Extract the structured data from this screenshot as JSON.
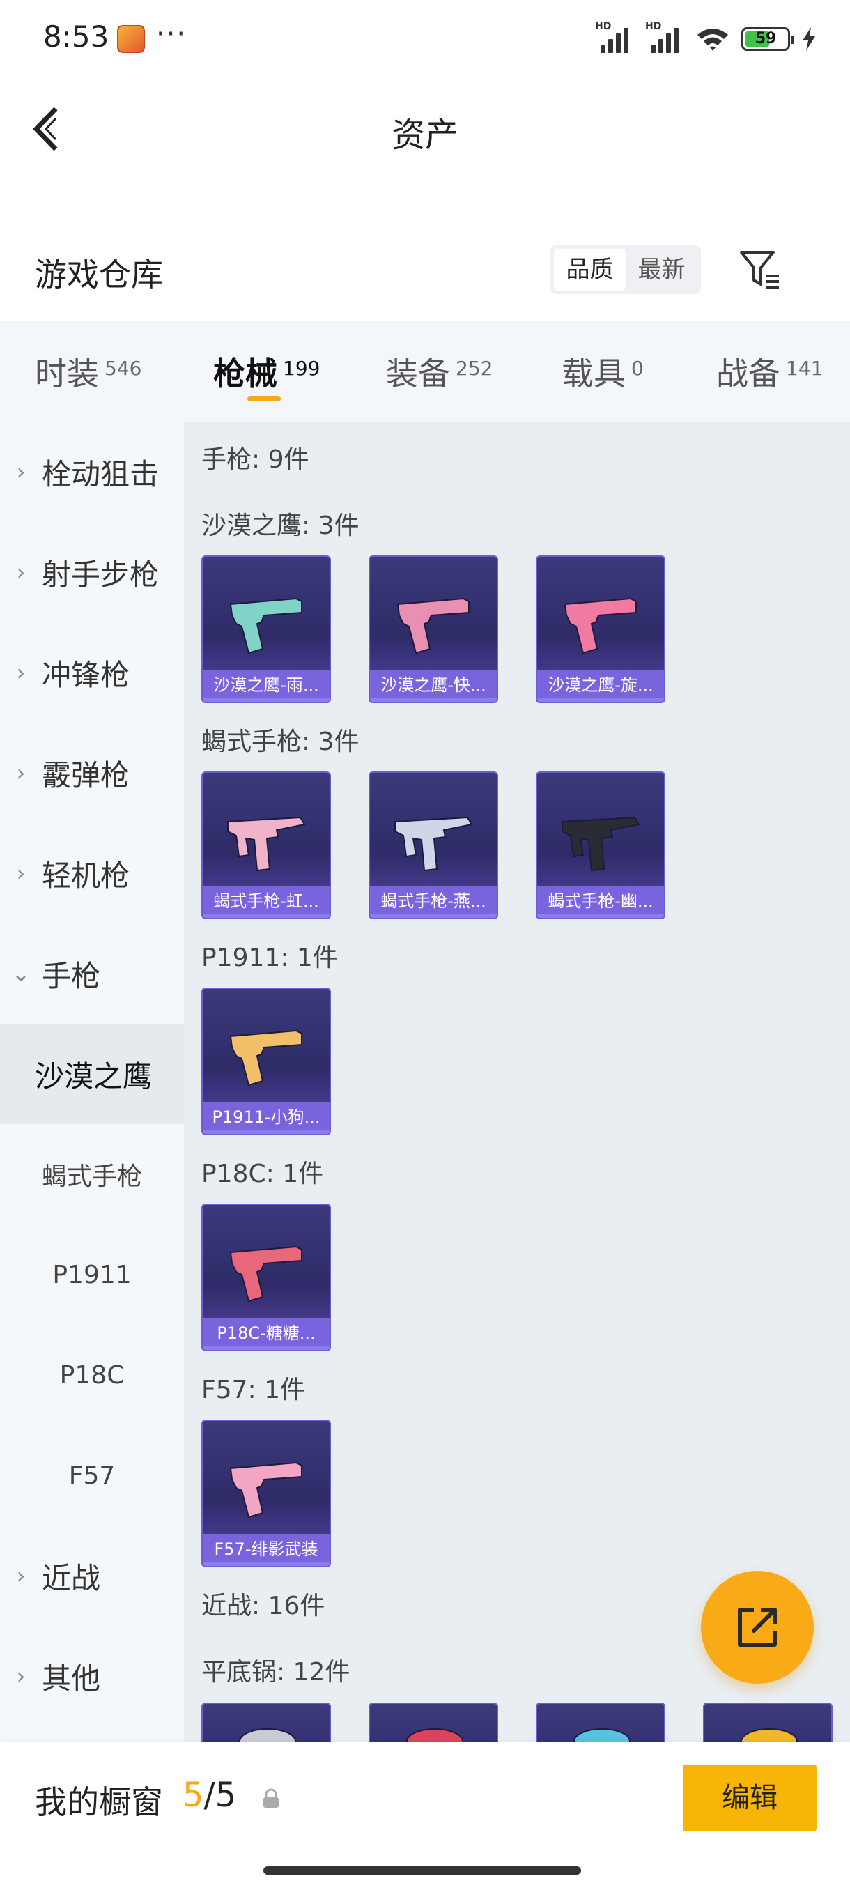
{
  "status_bar": {
    "time": "8:53",
    "dots": "···",
    "battery": "59"
  },
  "nav": {
    "title": "资产"
  },
  "header": {
    "title": "游戏仓库",
    "sort_quality": "品质",
    "sort_newest": "最新"
  },
  "tabs": [
    {
      "label": "时装",
      "count": "546"
    },
    {
      "label": "枪械",
      "count": "199"
    },
    {
      "label": "装备",
      "count": "252"
    },
    {
      "label": "载具",
      "count": "0"
    },
    {
      "label": "战备",
      "count": "141"
    }
  ],
  "sidebar": {
    "items": [
      {
        "label": "栓动狙击",
        "chevron": "›"
      },
      {
        "label": "射手步枪",
        "chevron": "›"
      },
      {
        "label": "冲锋枪",
        "chevron": "›"
      },
      {
        "label": "霰弹枪",
        "chevron": "›"
      },
      {
        "label": "轻机枪",
        "chevron": "›"
      },
      {
        "label": "手枪",
        "chevron": "⌄"
      },
      {
        "label": "沙漠之鹰"
      },
      {
        "label": "蝎式手枪"
      },
      {
        "label": "P1911"
      },
      {
        "label": "P18C"
      },
      {
        "label": "F57"
      },
      {
        "label": "近战",
        "chevron": "›"
      },
      {
        "label": "其他",
        "chevron": "›"
      }
    ]
  },
  "content": {
    "sections": [
      {
        "title": "手枪: 9件"
      },
      {
        "title": "沙漠之鹰: 3件",
        "cards": [
          {
            "name": "沙漠之鹰-雨...",
            "color": "#7fd3c7"
          },
          {
            "name": "沙漠之鹰-快...",
            "color": "#e88fb2"
          },
          {
            "name": "沙漠之鹰-旋...",
            "color": "#f07aa0"
          }
        ]
      },
      {
        "title": "蝎式手枪: 3件",
        "cards": [
          {
            "name": "蝎式手枪-虹...",
            "color": "#f1b3c9"
          },
          {
            "name": "蝎式手枪-燕...",
            "color": "#cfd6e8"
          },
          {
            "name": "蝎式手枪-幽...",
            "color": "#2b2b33"
          }
        ]
      },
      {
        "title": "P1911: 1件",
        "cards": [
          {
            "name": "P1911-小狗...",
            "color": "#f2c06a"
          }
        ]
      },
      {
        "title": "P18C: 1件",
        "cards": [
          {
            "name": "P18C-糖糖...",
            "color": "#e8677b"
          }
        ]
      },
      {
        "title": "F57: 1件",
        "cards": [
          {
            "name": "F57-绯影武装",
            "color": "#f2a6c4"
          }
        ]
      },
      {
        "title": "近战: 16件"
      },
      {
        "title": "平底锅: 12件",
        "cards": [
          {
            "name": "",
            "color": "#c9cbd6"
          },
          {
            "name": "",
            "color": "#d9465a"
          },
          {
            "name": "",
            "color": "#57c3e0"
          },
          {
            "name": "",
            "color": "#f4b52b"
          }
        ]
      }
    ]
  },
  "bottom": {
    "label": "我的橱窗",
    "current": "5",
    "separator": "/",
    "total": "5",
    "edit": "编辑"
  },
  "colors": {
    "accent": "#f8ab16",
    "card_bg": "#2e2b68",
    "card_caption": "#7c66e2"
  }
}
